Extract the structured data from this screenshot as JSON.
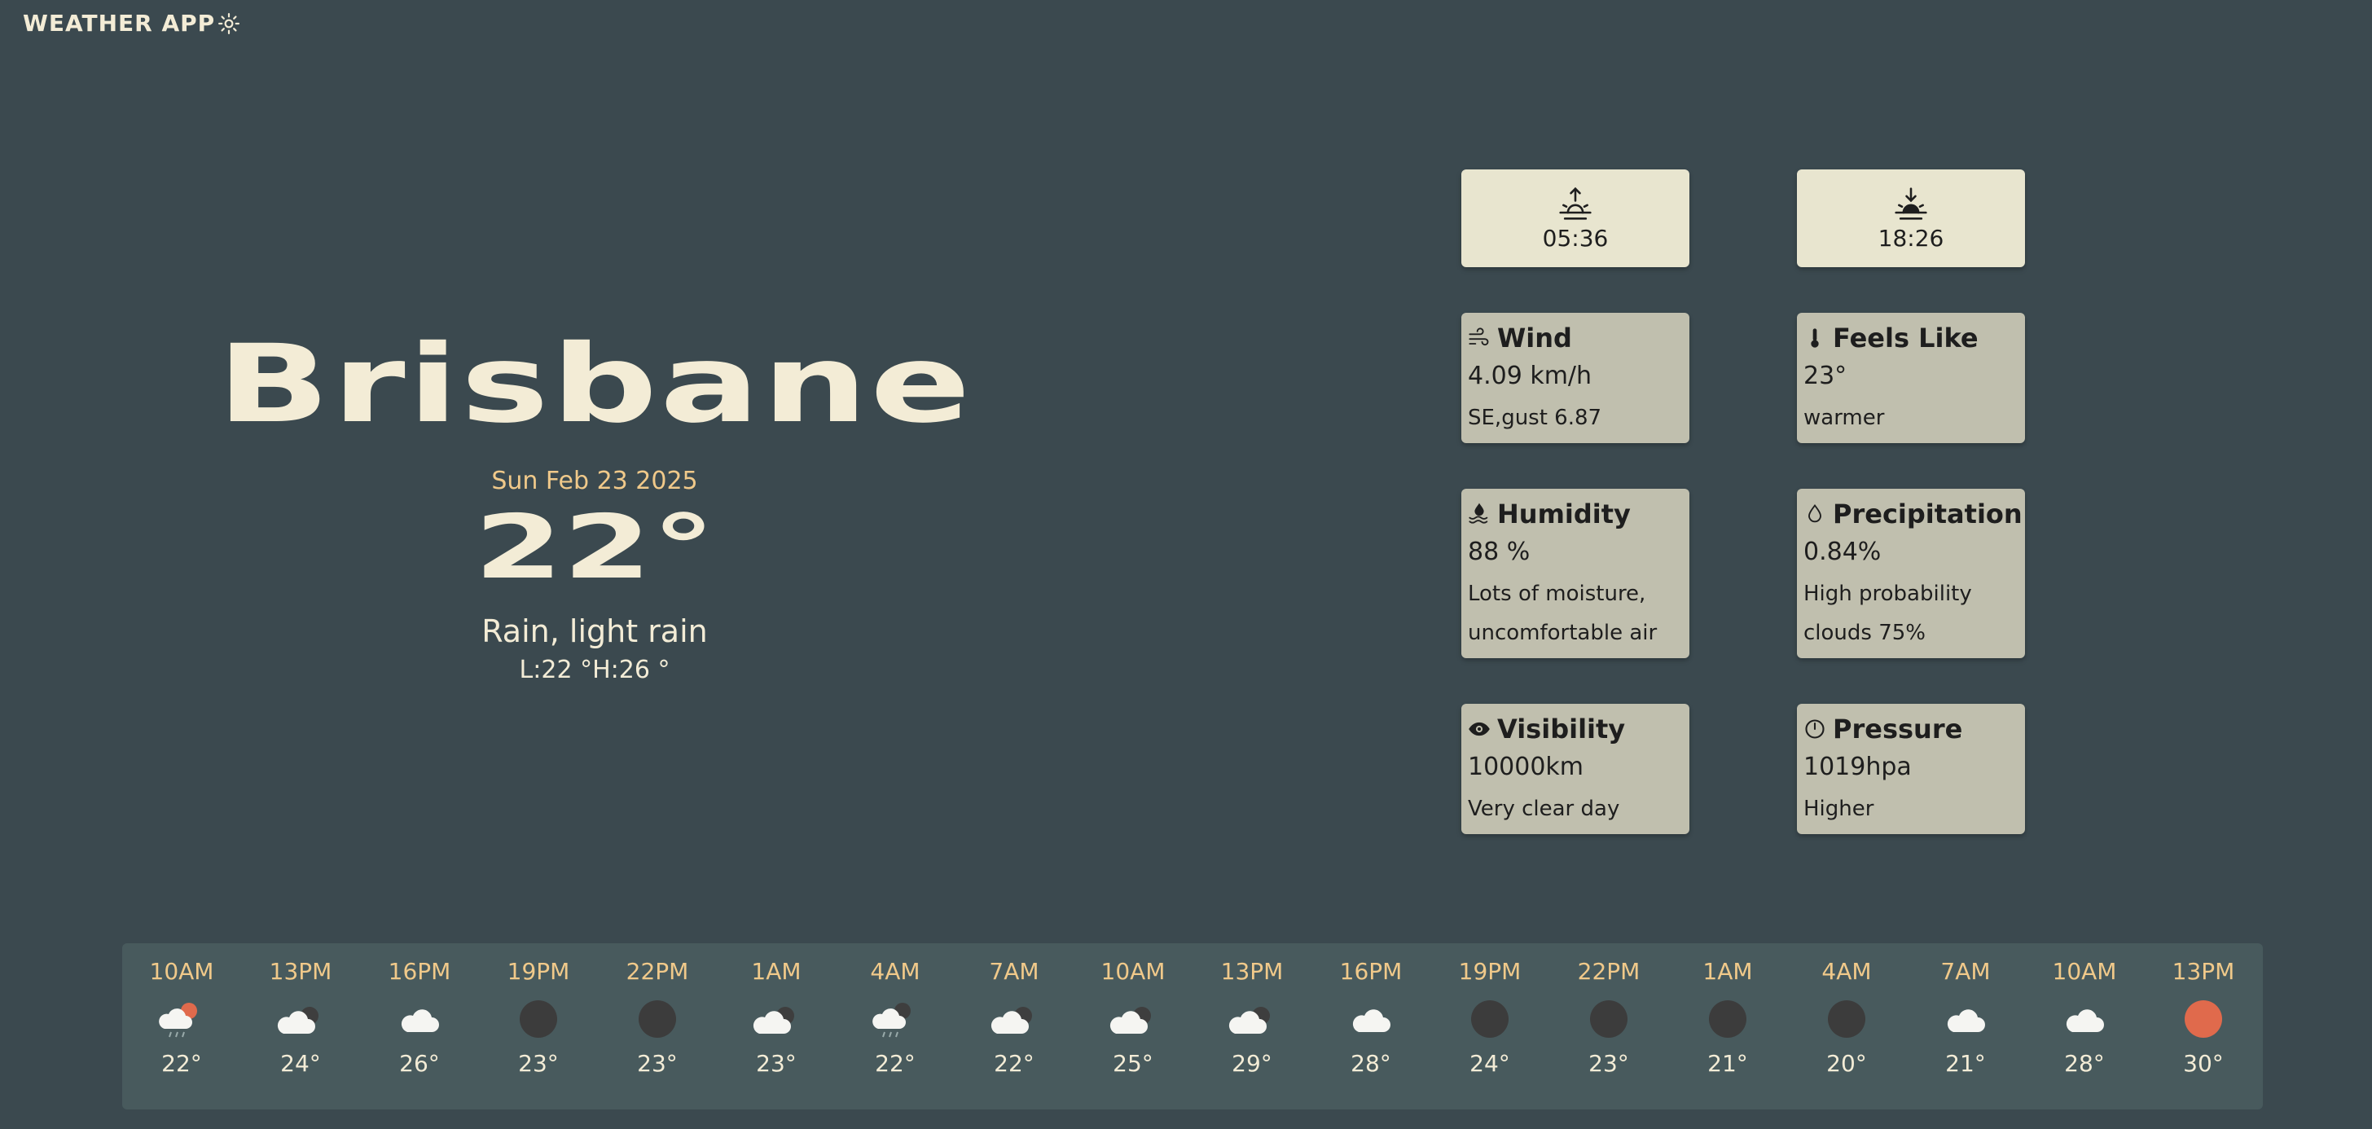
{
  "app": {
    "title": "WEATHER APP",
    "logo_icon": "sun-icon"
  },
  "current": {
    "city": "Brisbane",
    "date": "Sun Feb 23 2025",
    "temperature": "22°",
    "condition": "Rain, light rain",
    "low_high": "L:22 °H:26 °"
  },
  "sun": {
    "sunrise": {
      "icon": "sunrise-icon",
      "time": "05:36"
    },
    "sunset": {
      "icon": "sunset-icon",
      "time": "18:26"
    }
  },
  "details": {
    "wind": {
      "icon": "wind-icon",
      "title": "Wind",
      "value": "4.09 km/h",
      "note": "SE,gust 6.87"
    },
    "feels_like": {
      "icon": "thermometer-icon",
      "title": "Feels Like",
      "value": "23°",
      "note": "warmer"
    },
    "humidity": {
      "icon": "humidity-icon",
      "title": "Humidity",
      "value": "88 %",
      "note": "Lots of moisture,",
      "note2": "uncomfortable air"
    },
    "precipitation": {
      "icon": "droplet-icon",
      "title": "Precipitation",
      "value": "0.84%",
      "note": "High probability",
      "note2": "clouds 75%"
    },
    "visibility": {
      "icon": "eye-icon",
      "title": "Visibility",
      "value": "10000km",
      "note": "Very clear day"
    },
    "pressure": {
      "icon": "gauge-icon",
      "title": "Pressure",
      "value": "1019hpa",
      "note": "Higher"
    }
  },
  "hourly": [
    {
      "time": "10AM",
      "icon": "rain-sun-icon",
      "temp": "22°"
    },
    {
      "time": "13PM",
      "icon": "cloudy-icon",
      "temp": "24°"
    },
    {
      "time": "16PM",
      "icon": "cloud-icon",
      "temp": "26°"
    },
    {
      "time": "19PM",
      "icon": "night-icon",
      "temp": "23°"
    },
    {
      "time": "22PM",
      "icon": "night-icon",
      "temp": "23°"
    },
    {
      "time": "1AM",
      "icon": "cloudy-icon",
      "temp": "23°"
    },
    {
      "time": "4AM",
      "icon": "rain-cloud-icon",
      "temp": "22°"
    },
    {
      "time": "7AM",
      "icon": "cloudy-icon",
      "temp": "22°"
    },
    {
      "time": "10AM",
      "icon": "cloudy-icon",
      "temp": "25°"
    },
    {
      "time": "13PM",
      "icon": "cloudy-icon",
      "temp": "29°"
    },
    {
      "time": "16PM",
      "icon": "cloud-icon",
      "temp": "28°"
    },
    {
      "time": "19PM",
      "icon": "night-icon",
      "temp": "24°"
    },
    {
      "time": "22PM",
      "icon": "night-icon",
      "temp": "23°"
    },
    {
      "time": "1AM",
      "icon": "night-icon",
      "temp": "21°"
    },
    {
      "time": "4AM",
      "icon": "night-icon",
      "temp": "20°"
    },
    {
      "time": "7AM",
      "icon": "cloud-icon",
      "temp": "21°"
    },
    {
      "time": "10AM",
      "icon": "cloud-icon",
      "temp": "28°"
    },
    {
      "time": "13PM",
      "icon": "sun-icon",
      "temp": "30°"
    }
  ],
  "colors": {
    "background": "#3b494f",
    "accent": "#f0c98a",
    "text": "#f3ecd6",
    "card": "#c0bfae",
    "sun_card": "#e8e5cf",
    "strip": "#485a5d",
    "sun": "#e06a4c"
  }
}
